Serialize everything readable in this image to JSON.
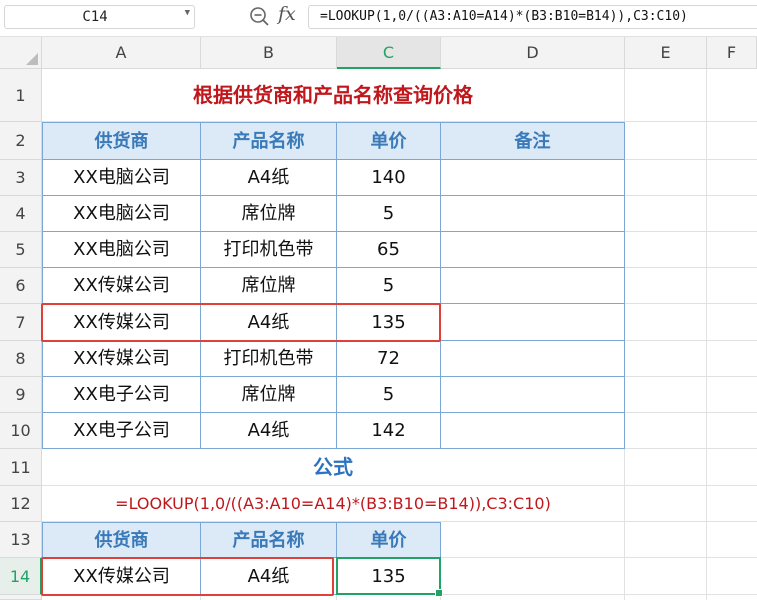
{
  "toolbar": {
    "name_box": "C14",
    "fx_label": "fx",
    "formula": "=LOOKUP(1,0/((A3:A10=A14)*(B3:B10=B14)),C3:C10)"
  },
  "columns": [
    "A",
    "B",
    "C",
    "D",
    "E",
    "F"
  ],
  "rows": [
    "1",
    "2",
    "3",
    "4",
    "5",
    "6",
    "7",
    "8",
    "9",
    "10",
    "11",
    "12",
    "13",
    "14"
  ],
  "sheet": {
    "title": "根据供货商和产品名称查询价格",
    "header": {
      "supplier": "供货商",
      "product": "产品名称",
      "price": "单价",
      "note": "备注"
    },
    "data": [
      {
        "supplier": "XX电脑公司",
        "product": "A4纸",
        "price": "140"
      },
      {
        "supplier": "XX电脑公司",
        "product": "席位牌",
        "price": "5"
      },
      {
        "supplier": "XX电脑公司",
        "product": "打印机色带",
        "price": "65"
      },
      {
        "supplier": "XX传媒公司",
        "product": "席位牌",
        "price": "5"
      },
      {
        "supplier": "XX传媒公司",
        "product": "A4纸",
        "price": "135"
      },
      {
        "supplier": "XX传媒公司",
        "product": "打印机色带",
        "price": "72"
      },
      {
        "supplier": "XX电子公司",
        "product": "席位牌",
        "price": "5"
      },
      {
        "supplier": "XX电子公司",
        "product": "A4纸",
        "price": "142"
      }
    ],
    "formula_heading": "公式",
    "formula_text": "=LOOKUP(1,0/((A3:A10=A14)*(B3:B10=B14)),C3:C10)",
    "lookup_header": {
      "supplier": "供货商",
      "product": "产品名称",
      "price": "单价"
    },
    "lookup_row": {
      "supplier": "XX传媒公司",
      "product": "A4纸",
      "price": "135"
    }
  },
  "colors": {
    "accent_green": "#21a366",
    "highlight_red": "#e0403a",
    "header_blue": "#dce9f6"
  }
}
